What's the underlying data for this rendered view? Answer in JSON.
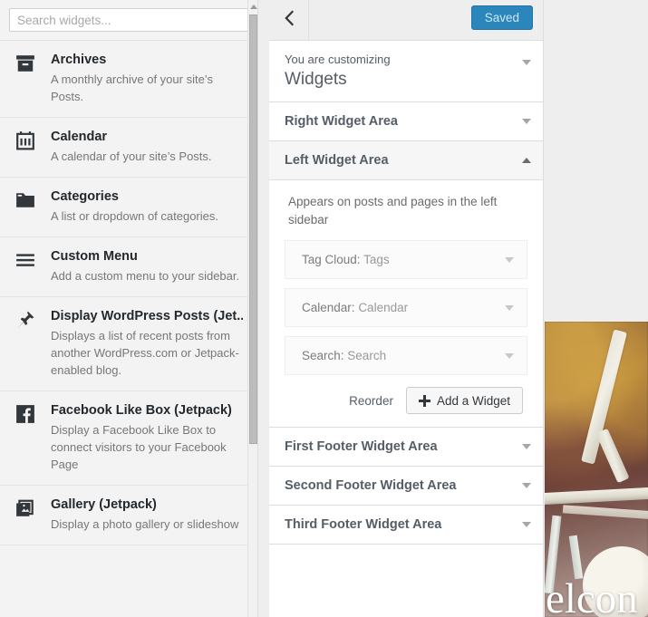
{
  "available_widgets": {
    "search": {
      "placeholder": "Search widgets...",
      "value": ""
    },
    "items": [
      {
        "icon": "archive-box-icon",
        "title": "Archives",
        "description": "A monthly archive of your site’s Posts."
      },
      {
        "icon": "calendar-icon",
        "title": "Calendar",
        "description": "A calendar of your site’s Posts."
      },
      {
        "icon": "folder-icon",
        "title": "Categories",
        "description": "A list or dropdown of categories."
      },
      {
        "icon": "menu-lines-icon",
        "title": "Custom Menu",
        "description": "Add a custom menu to your sidebar."
      },
      {
        "icon": "pushpin-icon",
        "title": "Display WordPress Posts (Jet...",
        "description": "Displays a list of recent posts from another WordPress.com or Jetpack-enabled blog."
      },
      {
        "icon": "facebook-icon",
        "title": "Facebook Like Box (Jetpack)",
        "description": "Display a Facebook Like Box to connect visitors to your Facebook Page"
      },
      {
        "icon": "gallery-images-icon",
        "title": "Gallery (Jetpack)",
        "description": "Display a photo gallery or slideshow"
      }
    ]
  },
  "customizer": {
    "header": {
      "back_icon": "chevron-left-icon",
      "save_label": "Saved"
    },
    "info": {
      "eyebrow": "You are customizing",
      "title": "Widgets",
      "toggle_icon": "caret-down-icon"
    },
    "sections": [
      {
        "title": "Right Widget Area",
        "state": "collapsed",
        "toggle_icon": "caret-down-icon"
      },
      {
        "title": "Left Widget Area",
        "state": "expanded",
        "toggle_icon": "caret-up-icon"
      }
    ],
    "left_widget_area": {
      "description": "Appears on posts and pages in the left sidebar",
      "widgets": [
        {
          "type": "Tag Cloud:",
          "name": "Tags",
          "toggle_icon": "caret-down-icon"
        },
        {
          "type": "Calendar:",
          "name": "Calendar",
          "toggle_icon": "caret-down-icon"
        },
        {
          "type": "Search:",
          "name": "Search",
          "toggle_icon": "caret-down-icon"
        }
      ],
      "reorder_label": "Reorder",
      "add_widget_label": "Add a Widget",
      "add_widget_icon": "plus-icon"
    },
    "footer_sections": [
      {
        "title": "First Footer Widget Area",
        "state": "collapsed",
        "toggle_icon": "caret-down-icon"
      },
      {
        "title": "Second Footer Widget Area",
        "state": "collapsed",
        "toggle_icon": "caret-down-icon"
      },
      {
        "title": "Third Footer Widget Area",
        "state": "collapsed",
        "toggle_icon": "caret-down-icon"
      }
    ]
  },
  "preview": {
    "headline_fragment": "elcon",
    "image_alt": "bicycle-photo"
  },
  "colors": {
    "accent_blue": "#2b87bb",
    "panel_bg": "#ffffff",
    "sidebar_bg": "#f3f3f3",
    "text_dark": "#23282d",
    "text_muted": "#777777",
    "border": "#dddddd"
  }
}
